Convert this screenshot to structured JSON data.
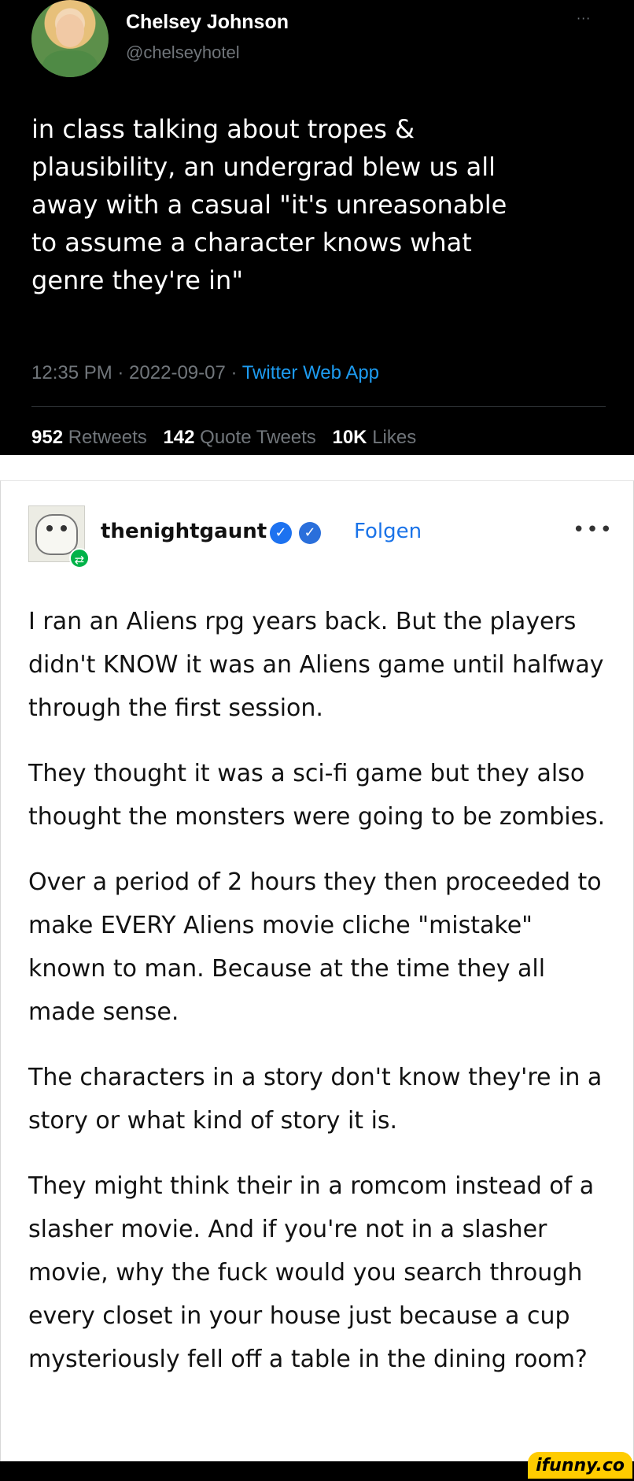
{
  "tweet": {
    "name": "Chelsey Johnson",
    "handle": "@chelseyhotel",
    "more": "···",
    "text": "in class talking about tropes &\nplausibility, an undergrad blew us all\naway with a casual \"it's unreasonable\nto assume a character knows what\ngenre they're in\"",
    "time": "12:35 PM · 2022-09-07 · ",
    "source": "Twitter Web App",
    "retweets_count": "952",
    "retweets_label": "Retweets",
    "quotes_count": "142",
    "quotes_label": "Quote Tweets",
    "likes_count": "10K",
    "likes_label": "Likes"
  },
  "post": {
    "username": "thenightgaunt",
    "follow_label": "Folgen",
    "more": "•••",
    "paragraphs": [
      "I ran an Aliens rpg years back. But the players didn't KNOW it was an Aliens game until halfway through the first session.",
      "They thought it was a sci-fi game but they also thought the monsters were going to be zombies.",
      "Over a period of 2 hours they then proceeded to make EVERY Aliens movie cliche \"mistake\" known to man. Because at the time they all made sense.",
      "The characters in a story don't know they're in a story or what kind of story it is.",
      "They might think their in a romcom instead of a slasher movie. And if you're not in a slasher movie, why the fuck would you search through every closet in your house just because a cup mysteriously fell off a table in the dining room?"
    ]
  },
  "watermark": "ifunny.co",
  "colors": {
    "twitter_link": "#1d9bf0",
    "tumblr_follow": "#1a73e8",
    "verified_badge": "#1d72f0",
    "reblog_green": "#00b248"
  },
  "icons": {
    "verified": "checkmark-badge",
    "reblog": "reblog-arrows"
  }
}
